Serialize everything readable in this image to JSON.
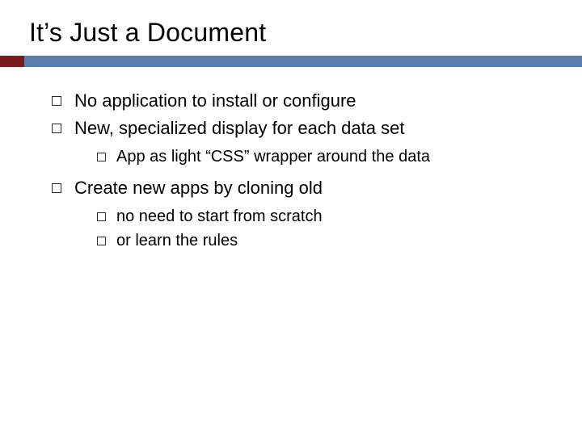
{
  "title": "It’s Just a Document",
  "bullets": [
    {
      "text": "No application to install or configure"
    },
    {
      "text": "New, specialized display for each data set",
      "children": [
        {
          "text": "App as light “CSS” wrapper around the data"
        }
      ]
    },
    {
      "text": "Create new apps by cloning old",
      "children": [
        {
          "text": "no need to start from scratch"
        },
        {
          "text": "or learn the rules"
        }
      ]
    }
  ]
}
